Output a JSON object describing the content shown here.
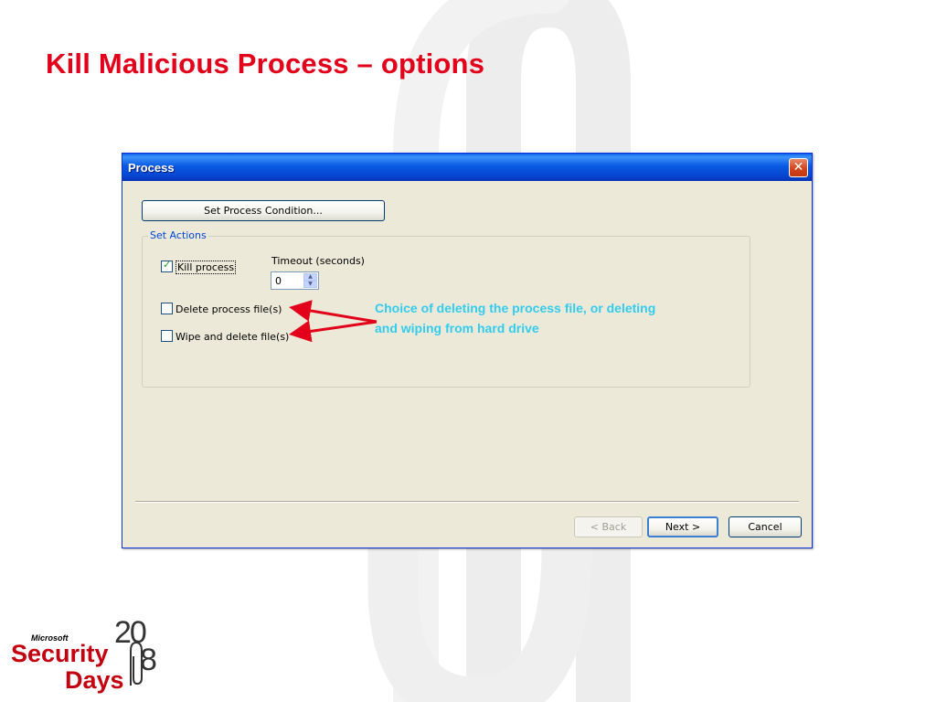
{
  "slide": {
    "title": "Kill Malicious Process – options"
  },
  "dialog": {
    "title": "Process",
    "close_icon": "close-icon",
    "set_condition_button": "Set Process Condition...",
    "set_actions_group": "Set Actions",
    "kill_process": {
      "label": "Kill process",
      "checked": true
    },
    "timeout_label": "Timeout (seconds)",
    "timeout_value": "0",
    "delete_files": {
      "label": "Delete process file(s)",
      "checked": false
    },
    "wipe_files": {
      "label": "Wipe and delete file(s)",
      "checked": false
    },
    "back_button": "< Back",
    "next_button": "Next >",
    "cancel_button": "Cancel"
  },
  "annotation": {
    "text": "Choice of deleting the process file, or deleting and wiping from hard drive",
    "color": "#33ccee",
    "arrow_color": "#e2001a"
  },
  "logo": {
    "brand": "Microsoft",
    "line1": "Security",
    "line2": "Days",
    "year_prefix": "20",
    "year_suffix": "8"
  },
  "colors": {
    "title": "#e2001a",
    "titlebar": "#0a5ae3",
    "dialog_bg": "#ece9d8"
  }
}
